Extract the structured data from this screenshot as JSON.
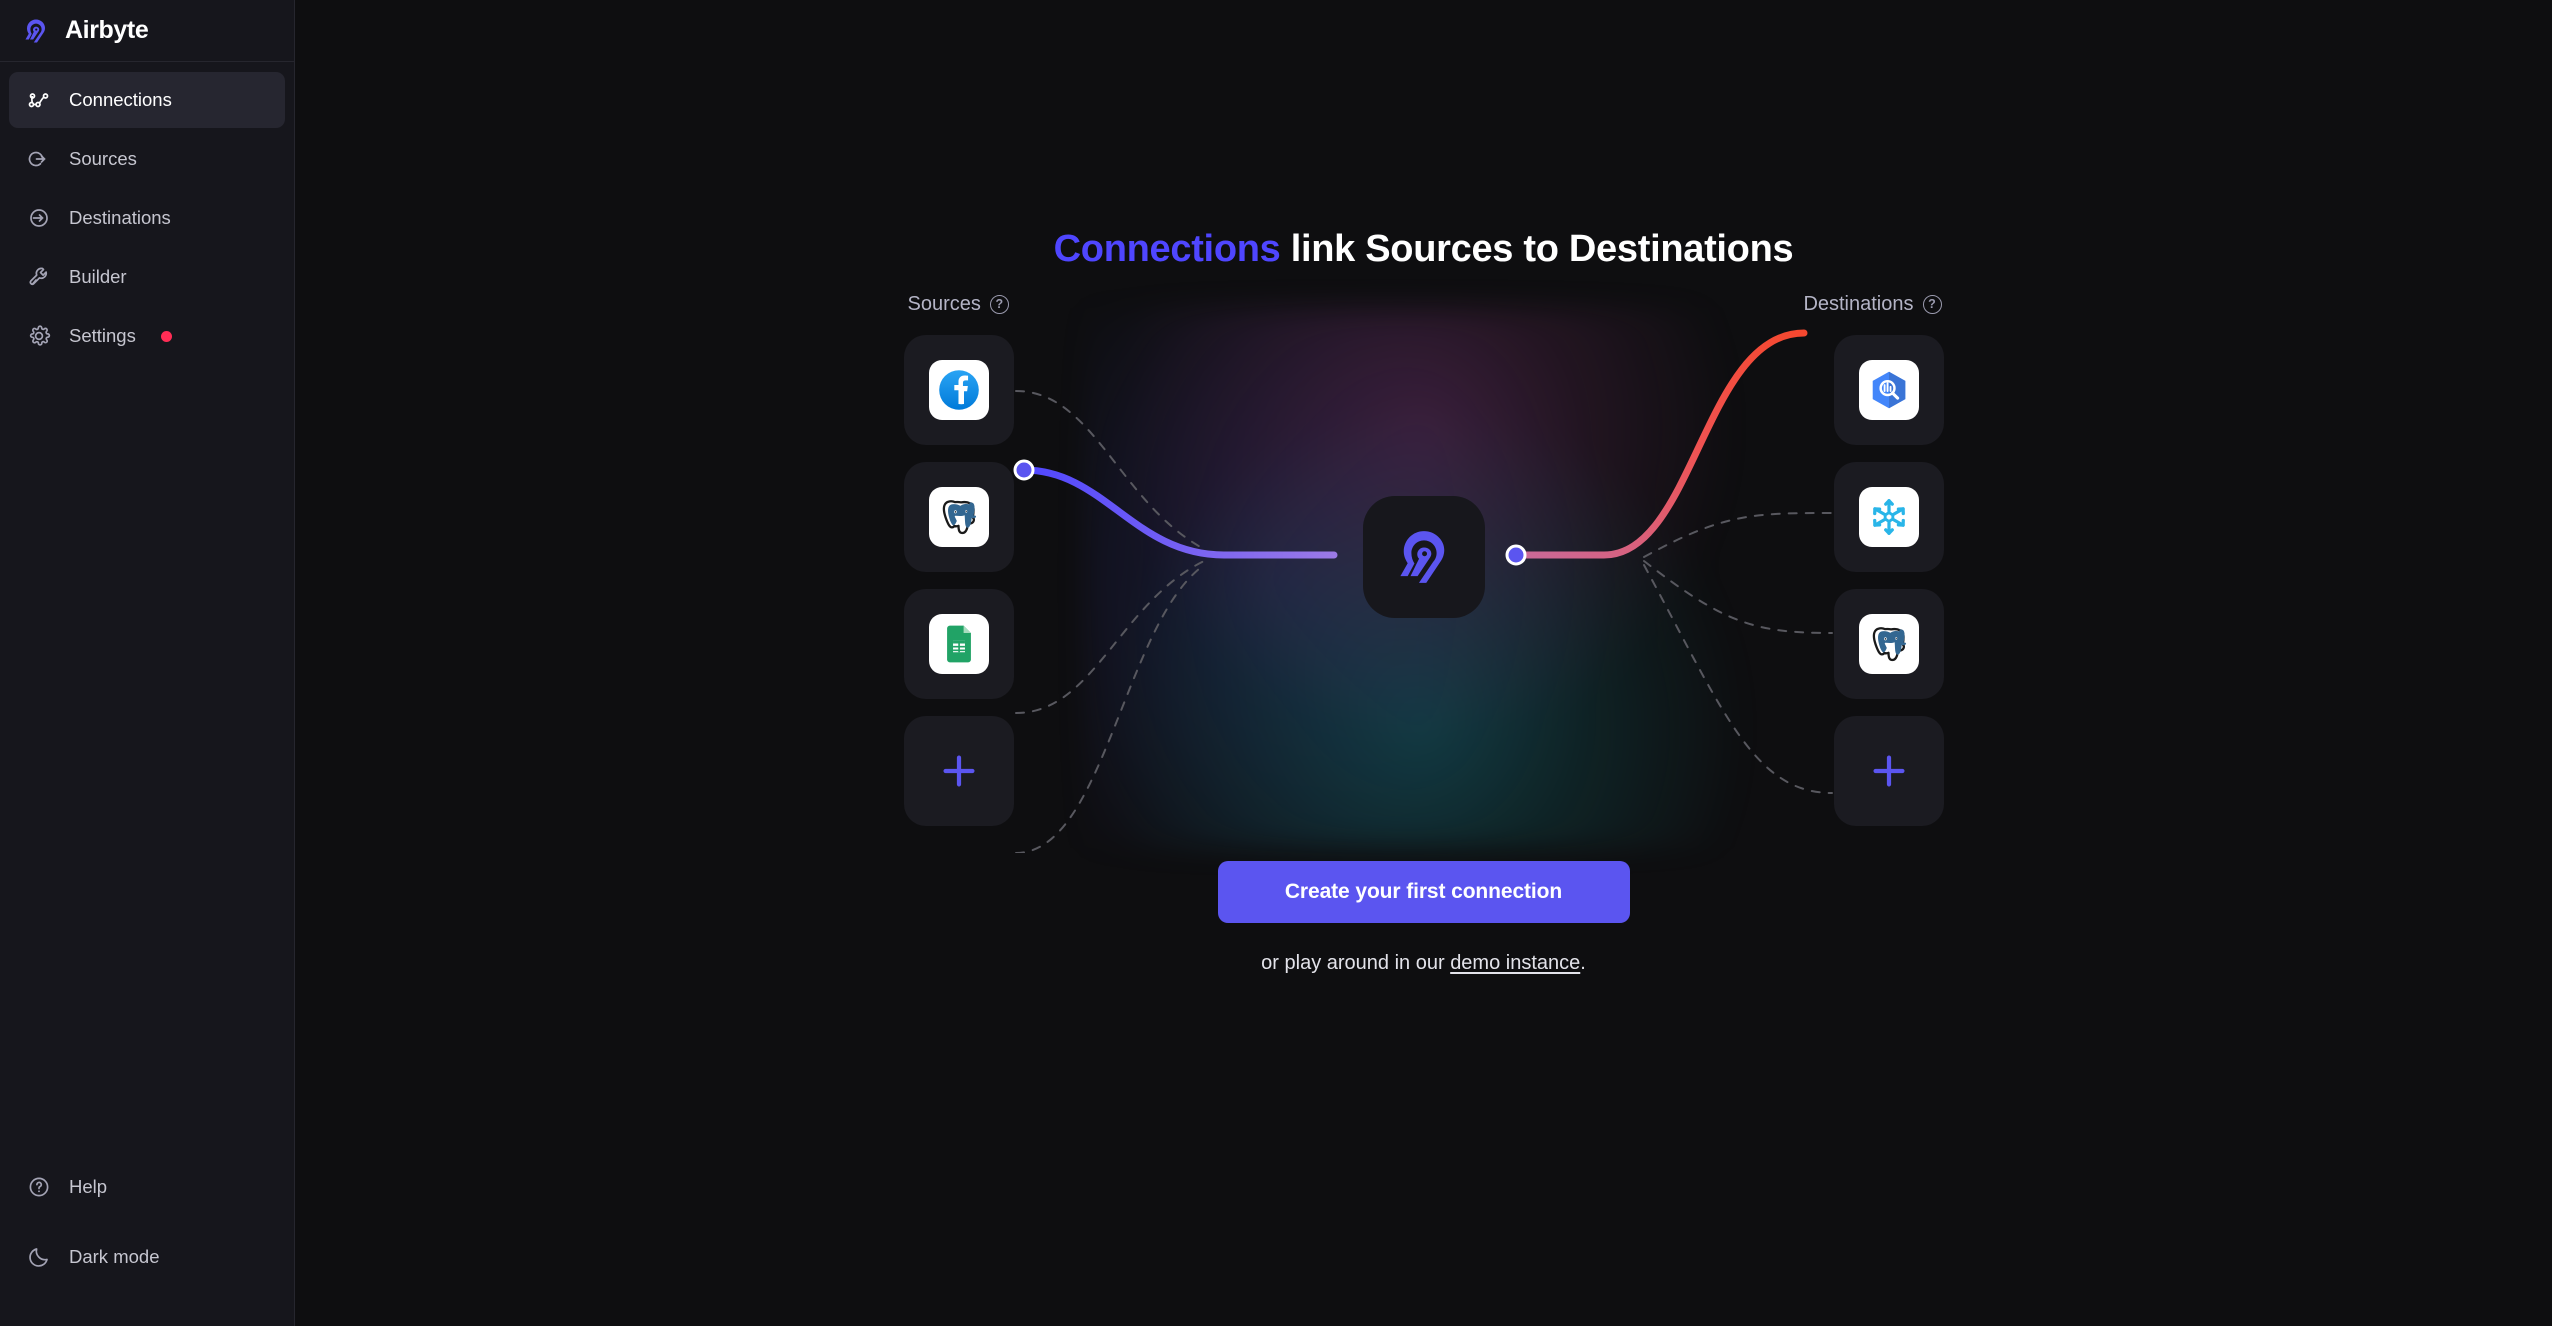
{
  "brand": {
    "name": "Airbyte",
    "logo_icon": "airbyte-logo"
  },
  "sidebar": {
    "items": [
      {
        "label": "Connections",
        "icon": "connections-icon",
        "active": true,
        "badge": false
      },
      {
        "label": "Sources",
        "icon": "source-arrow-out-icon",
        "active": false,
        "badge": false
      },
      {
        "label": "Destinations",
        "icon": "destination-arrow-in-icon",
        "active": false,
        "badge": false
      },
      {
        "label": "Builder",
        "icon": "wrench-icon",
        "active": false,
        "badge": false
      },
      {
        "label": "Settings",
        "icon": "gear-icon",
        "active": false,
        "badge": true
      }
    ],
    "bottom_items": [
      {
        "label": "Help",
        "icon": "help-circle-icon"
      },
      {
        "label": "Dark mode",
        "icon": "moon-icon"
      }
    ]
  },
  "main": {
    "headline_accent": "Connections",
    "headline_rest": " link Sources to Destinations",
    "sources_label": "Sources",
    "destinations_label": "Destinations",
    "help_glyph": "?",
    "sources": [
      {
        "name": "Facebook",
        "icon": "facebook-icon"
      },
      {
        "name": "Postgres",
        "icon": "postgres-icon"
      },
      {
        "name": "Google Sheets",
        "icon": "google-sheets-icon"
      },
      {
        "name": "Add source",
        "icon": "plus-icon"
      }
    ],
    "destinations": [
      {
        "name": "BigQuery",
        "icon": "bigquery-icon"
      },
      {
        "name": "Snowflake",
        "icon": "snowflake-icon"
      },
      {
        "name": "Postgres",
        "icon": "postgres-icon"
      },
      {
        "name": "Add destination",
        "icon": "plus-icon"
      }
    ],
    "hub_icon": "airbyte-logo",
    "cta_label": "Create your first connection",
    "sub_prefix": "or play around in our ",
    "sub_link": "demo instance",
    "sub_suffix": "."
  },
  "colors": {
    "accent": "#5b55f0",
    "headline_accent": "#4f46ff",
    "badge": "#ff2d55",
    "source_wire": "#6a5bf2",
    "dest_wire": "#f0494a",
    "sidebar_bg": "#16161c",
    "main_bg": "#0e0e10",
    "tile_bg": "#1b1b21"
  }
}
